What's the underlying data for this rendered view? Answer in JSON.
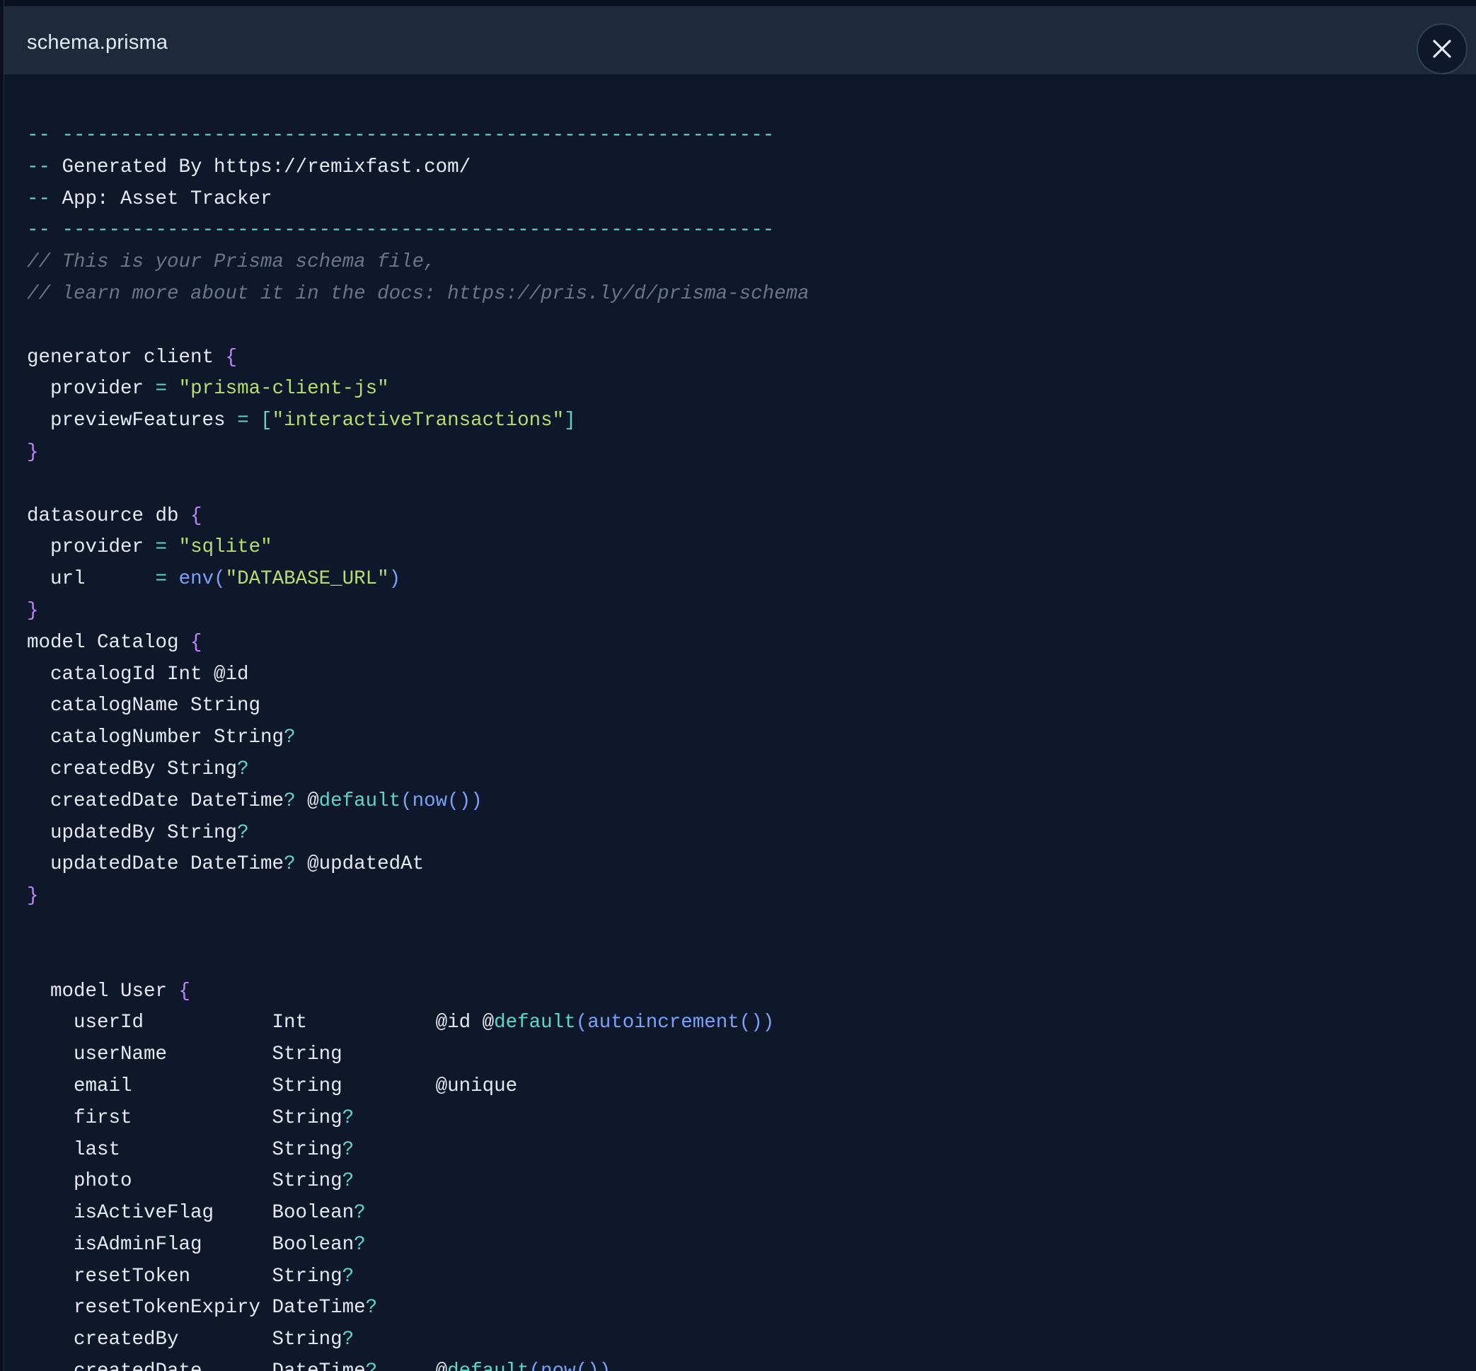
{
  "window": {
    "title": "schema.prisma",
    "close_icon": "close-icon"
  },
  "code": {
    "language": "prisma",
    "lines": [
      "-- -------------------------------------------------------------",
      "-- Generated By https://remixfast.com/",
      "-- App: Asset Tracker",
      "-- -------------------------------------------------------------",
      "// This is your Prisma schema file,",
      "// learn more about it in the docs: https://pris.ly/d/prisma-schema",
      "",
      "generator client {",
      "  provider = \"prisma-client-js\"",
      "  previewFeatures = [\"interactiveTransactions\"]",
      "}",
      "",
      "datasource db {",
      "  provider = \"sqlite\"",
      "  url      = env(\"DATABASE_URL\")",
      "}",
      "model Catalog {",
      "  catalogId Int @id",
      "  catalogName String",
      "  catalogNumber String?",
      "  createdBy String?",
      "  createdDate DateTime? @default(now())",
      "  updatedBy String?",
      "  updatedDate DateTime? @updatedAt",
      "}",
      "",
      "",
      "  model User {",
      "    userId           Int           @id @default(autoincrement())",
      "    userName         String",
      "    email            String        @unique",
      "    first            String?",
      "    last             String?",
      "    photo            String?",
      "    isActiveFlag     Boolean?",
      "    isAdminFlag      Boolean?",
      "    resetToken       String?",
      "    resetTokenExpiry DateTime?",
      "    createdBy        String?",
      "    createdDate      DateTime?     @default(now())"
    ]
  },
  "colors": {
    "background": "#0f172a",
    "header": "#1e293b",
    "comment": "#6b7787",
    "brace": "#c084fc",
    "operator": "#5fd6c8",
    "string": "#b5dd6f",
    "function": "#7aa2f7"
  }
}
